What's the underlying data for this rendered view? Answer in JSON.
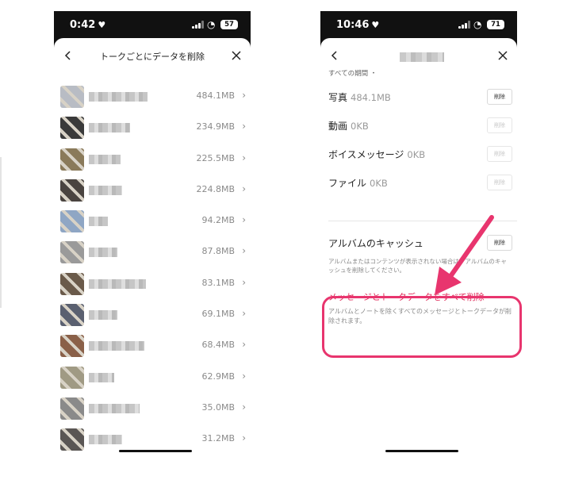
{
  "left_screen": {
    "status": {
      "time": "0:42",
      "battery": "57"
    },
    "title": "トークごとにデータを削除",
    "rows": [
      {
        "size": "484.1MB",
        "avatar_color": "#b8bcc4",
        "name_width": 74
      },
      {
        "size": "234.9MB",
        "avatar_color": "#3a3a3a",
        "name_width": 52
      },
      {
        "size": "225.5MB",
        "avatar_color": "#8a7a5a",
        "name_width": 40
      },
      {
        "size": "224.8MB",
        "avatar_color": "#4a4440",
        "name_width": 42
      },
      {
        "size": "94.2MB",
        "avatar_color": "#8fa6c4",
        "name_width": 24
      },
      {
        "size": "87.8MB",
        "avatar_color": "#9a9a9a",
        "name_width": 36
      },
      {
        "size": "83.1MB",
        "avatar_color": "#6a5a4a",
        "name_width": 72
      },
      {
        "size": "69.1MB",
        "avatar_color": "#5a6070",
        "name_width": 36
      },
      {
        "size": "68.4MB",
        "avatar_color": "#8a6048",
        "name_width": 70
      },
      {
        "size": "62.9MB",
        "avatar_color": "#a09a84",
        "name_width": 32
      },
      {
        "size": "35.0MB",
        "avatar_color": "#8a8a8a",
        "name_width": 64
      },
      {
        "size": "31.2MB",
        "avatar_color": "#5a5654",
        "name_width": 42
      }
    ]
  },
  "right_screen": {
    "status": {
      "time": "10:46",
      "battery": "71"
    },
    "section_label": "すべての期間 ・",
    "media": [
      {
        "label": "写真",
        "size": "484.1MB",
        "button": "削除",
        "enabled": true
      },
      {
        "label": "動画",
        "size": "0KB",
        "button": "削除",
        "enabled": false
      },
      {
        "label": "ボイスメッセージ",
        "size": "0KB",
        "button": "削除",
        "enabled": false
      },
      {
        "label": "ファイル",
        "size": "0KB",
        "button": "削除",
        "enabled": false
      }
    ],
    "album_cache": {
      "label": "アルバムのキャッシュ",
      "button": "削除",
      "description": "アルバムまたはコンテンツが表示されない場合は、アルバムのキャッシュを削除してください。"
    },
    "delete_all": {
      "title": "メッセージとトークデータをすべて削除",
      "description": "アルバムとノートを除くすべてのメッセージとトークデータが削除されます。"
    }
  },
  "colors": {
    "accent": "#e02a59",
    "highlight": "#e8356e"
  }
}
